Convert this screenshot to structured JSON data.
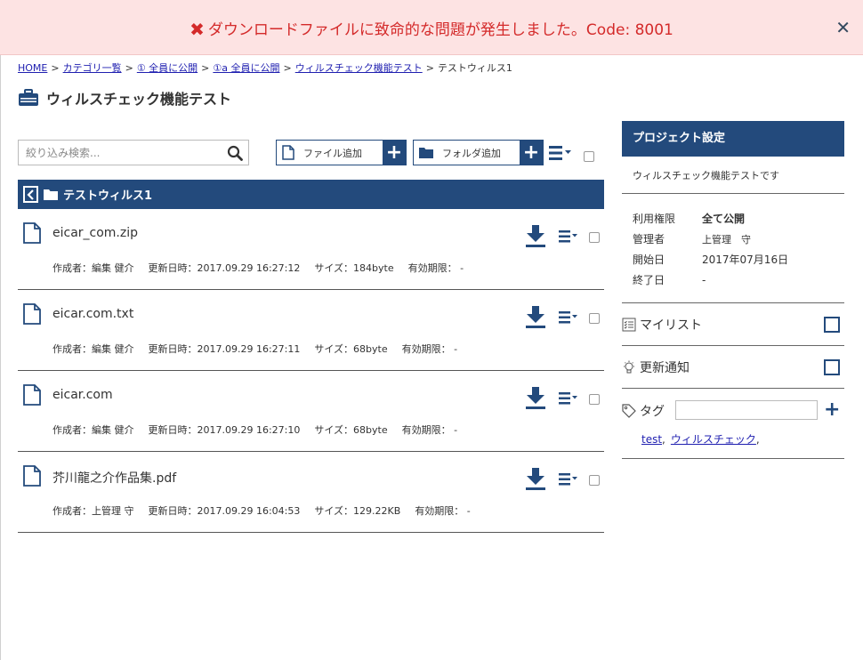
{
  "banner": {
    "message": "ダウンロードファイルに致命的な問題が発生しました。Code: 8001",
    "close_glyph": "✕",
    "error_glyph": "✖",
    "color": "#d42a2a"
  },
  "breadcrumb": [
    {
      "label": "HOME",
      "link": true
    },
    {
      "label": "カテゴリ一覧",
      "link": true
    },
    {
      "label": "① 全員に公開",
      "link": true
    },
    {
      "label": "①a 全員に公開",
      "link": true
    },
    {
      "label": "ウィルスチェック機能テスト",
      "link": true
    },
    {
      "label": "テストウィルス1",
      "link": false
    }
  ],
  "breadcrumb_sep": ">",
  "page": {
    "title": "ウィルスチェック機能テスト"
  },
  "toolbar": {
    "search_placeholder": "絞り込み検索...",
    "add_file_label": "ファイル追加",
    "add_folder_label": "フォルダ追加",
    "plus_glyph": "+"
  },
  "folder": {
    "title": "テストウィルス1"
  },
  "files": [
    {
      "name": "eicar_com.zip",
      "creator": "作成者：編集 健介",
      "updated": "更新日時：2017.09.29 16:27:12",
      "size": "サイズ：184byte",
      "expiry": "有効期限： -"
    },
    {
      "name": "eicar.com.txt",
      "creator": "作成者：編集 健介",
      "updated": "更新日時：2017.09.29 16:27:11",
      "size": "サイズ：68byte",
      "expiry": "有効期限： -"
    },
    {
      "name": "eicar.com",
      "creator": "作成者：編集 健介",
      "updated": "更新日時：2017.09.29 16:27:10",
      "size": "サイズ：68byte",
      "expiry": "有効期限： -"
    },
    {
      "name": "芥川龍之介作品集.pdf",
      "creator": "作成者：上管理 守",
      "updated": "更新日時：2017.09.29 16:04:53",
      "size": "サイズ：129.22KB",
      "expiry": "有効期限： -"
    }
  ],
  "project": {
    "header": "プロジェクト設定",
    "description": "ウィルスチェック機能テストです",
    "info": [
      {
        "key": "利用権限",
        "value": "全て公開",
        "bold": true
      },
      {
        "key": "管理者",
        "value": "上管理　守",
        "bold": false
      },
      {
        "key": "開始日",
        "value": "2017年07月16日",
        "bold": false
      },
      {
        "key": "終了日",
        "value": "-",
        "bold": false
      }
    ],
    "mylist_label": "マイリスト",
    "notify_label": "更新通知",
    "tag_label": "タグ",
    "tag_input_value": "",
    "tags": [
      "test",
      "ウィルスチェック"
    ],
    "tag_sep": ","
  },
  "colors": {
    "navy": "#234a7c",
    "banner_bg": "#fde3e3",
    "link": "#1f1fb0"
  }
}
